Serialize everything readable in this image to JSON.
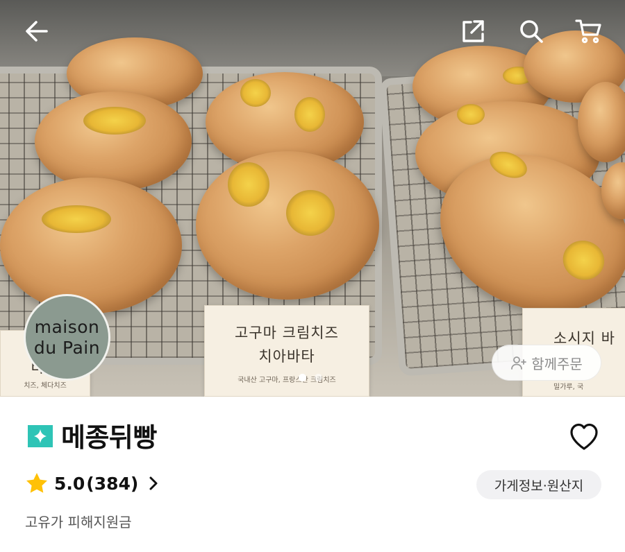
{
  "top_bar": {
    "back_icon": "arrow-left-icon",
    "share_icon": "share-external-icon",
    "search_icon": "search-icon",
    "cart_icon": "cart-icon"
  },
  "hero": {
    "label_center_line1": "고구마 크림치즈",
    "label_center_line2": "치아바타",
    "label_center_sub": "국내산 고구마, 프랑스산 크림치즈",
    "label_left_line1": "치",
    "label_left_line2": "바타",
    "label_left_sub": "치즈, 체다치즈",
    "label_right_line1": "소시지 바",
    "label_right_sub": "밀가루, 국",
    "logo_line1": "maison",
    "logo_line2": "du Pain",
    "page_dots_total": 2,
    "page_dots_active": 1,
    "group_order_label": "함께주문"
  },
  "store": {
    "name": "메종뒤빵",
    "badge_color": "#2ec4b6",
    "rating": "5.0",
    "review_count": "(384)",
    "info_button_label": "가게정보·원산지",
    "support_text": "고유가 피해지원금"
  },
  "colors": {
    "star": "#ffc107",
    "accent_teal": "#2ec4b6"
  }
}
